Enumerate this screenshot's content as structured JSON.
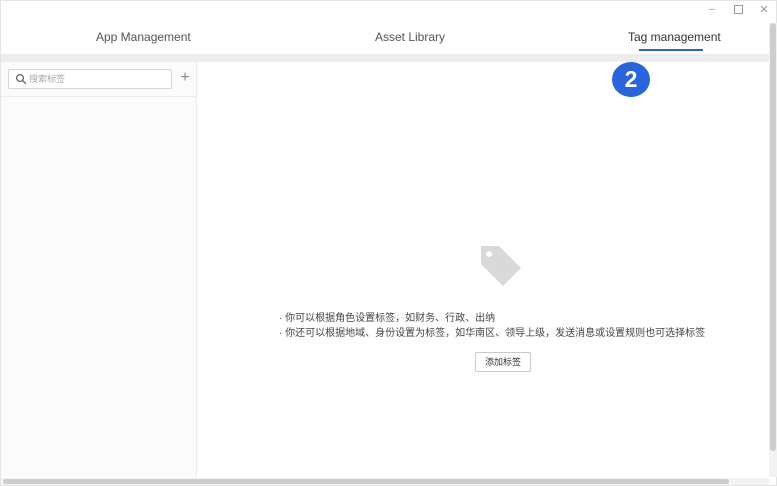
{
  "window_controls": {
    "minimize": "−",
    "close": "✕"
  },
  "tabs": [
    {
      "label": "App Management"
    },
    {
      "label": "Asset Library"
    },
    {
      "label": "Tag management",
      "active": true
    }
  ],
  "badge": {
    "number": "2",
    "color": "#2b63dc"
  },
  "sidebar": {
    "search": {
      "placeholder": "搜索标签",
      "value": ""
    },
    "add_label": "+",
    "icons": {
      "search": "search-icon",
      "add": "plus-icon"
    }
  },
  "main": {
    "empty_icon": "tag-icon",
    "hints": [
      "· 你可以根据角色设置标签，如财务、行政、出纳",
      "· 你还可以根据地域、身份设置为标签，如华南区、领导上级，发送消息或设置规则也可选择标签"
    ],
    "add_tag_button": "添加标签"
  },
  "colors": {
    "accent": "#2e63c7",
    "sidebar_bg": "#fbfbfb",
    "strip_bg": "#ededed",
    "tag_icon": "#d9d9d9"
  }
}
